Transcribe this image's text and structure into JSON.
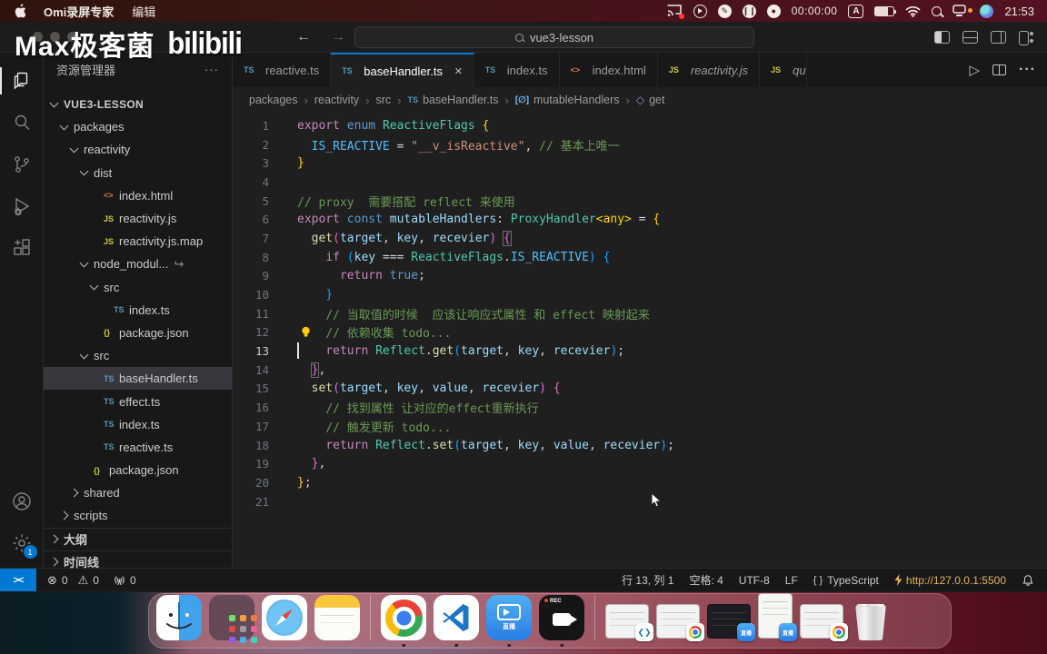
{
  "menubar": {
    "apps": [
      "Omi录屏专家",
      "编辑"
    ],
    "timer": "00:00:00",
    "input_source": "A",
    "time": "21:53"
  },
  "watermark": {
    "text": "Max极客菌",
    "logo": "bilibili"
  },
  "titlebar": {
    "search": "vue3-lesson"
  },
  "activity_bar": {
    "items": [
      "explorer",
      "search",
      "source-control",
      "run-debug",
      "extensions",
      "account",
      "settings"
    ],
    "settings_badge": "1"
  },
  "sidebar": {
    "title": "资源管理器",
    "more": "···",
    "tree": [
      {
        "label": "VUE3-LESSON",
        "chev": "down",
        "indent": 0,
        "root": true
      },
      {
        "label": "packages",
        "chev": "down",
        "indent": 1
      },
      {
        "label": "reactivity",
        "chev": "down",
        "indent": 2
      },
      {
        "label": "dist",
        "chev": "down",
        "indent": 3
      },
      {
        "label": "index.html",
        "icon": "html",
        "indent": 4
      },
      {
        "label": "reactivity.js",
        "icon": "js",
        "indent": 4
      },
      {
        "label": "reactivity.js.map",
        "icon": "js",
        "indent": 4
      },
      {
        "label": "node_modul...",
        "chev": "down",
        "indent": 3,
        "suffix": "↪"
      },
      {
        "label": "src",
        "chev": "down",
        "indent": 4
      },
      {
        "label": "index.ts",
        "icon": "ts",
        "indent": 5
      },
      {
        "label": "package.json",
        "icon": "json",
        "indent": 4
      },
      {
        "label": "src",
        "chev": "down",
        "indent": 3
      },
      {
        "label": "baseHandler.ts",
        "icon": "ts",
        "indent": 4,
        "selected": true
      },
      {
        "label": "effect.ts",
        "icon": "ts",
        "indent": 4
      },
      {
        "label": "index.ts",
        "icon": "ts",
        "indent": 4
      },
      {
        "label": "reactive.ts",
        "icon": "ts",
        "indent": 4
      },
      {
        "label": "package.json",
        "icon": "json",
        "indent": 3
      },
      {
        "label": "shared",
        "chev": "right",
        "indent": 2
      },
      {
        "label": "scripts",
        "chev": "right",
        "indent": 1
      },
      {
        "label": "大纲",
        "chev": "right",
        "indent": 0,
        "section": true
      },
      {
        "label": "时间线",
        "chev": "right",
        "indent": 0,
        "section": true
      }
    ]
  },
  "editor": {
    "tabs": [
      {
        "icon": "ts",
        "label": "reactive.ts"
      },
      {
        "icon": "ts",
        "label": "baseHandler.ts",
        "active": true,
        "close": "×"
      },
      {
        "icon": "ts",
        "label": "index.ts"
      },
      {
        "icon": "html",
        "label": "index.html"
      },
      {
        "icon": "js",
        "label": "reactivity.js",
        "italic": true
      },
      {
        "icon": "js",
        "label": "qu",
        "italic": true,
        "truncated": true
      }
    ],
    "actions": {
      "run": "▷",
      "more": "···"
    },
    "breadcrumb": [
      {
        "label": "packages"
      },
      {
        "label": "reactivity"
      },
      {
        "label": "src"
      },
      {
        "label": "baseHandler.ts",
        "icon": "ts"
      },
      {
        "label": "mutableHandlers",
        "icon": "symbol-variable",
        "glyph": "[∅]"
      },
      {
        "label": "get",
        "icon": "symbol-method",
        "glyph": "◇"
      }
    ],
    "code": {
      "cursor_line": 13,
      "bulb_line": 12,
      "lines": [
        {
          "n": "1",
          "t": [
            [
              "export ",
              "kw"
            ],
            [
              "enum ",
              "kw2"
            ],
            [
              "ReactiveFlags",
              "type"
            ],
            [
              " ",
              "pu"
            ],
            [
              "{",
              "b1"
            ]
          ]
        },
        {
          "n": "2",
          "t": [
            [
              "  ",
              "pu"
            ],
            [
              "IS_REACTIVE",
              "cn"
            ],
            [
              " = ",
              "pu"
            ],
            [
              "\"__v_isReactive\"",
              "st"
            ],
            [
              ",",
              "pu"
            ],
            [
              " ",
              "pu"
            ],
            [
              "// 基本上唯一",
              "cm"
            ]
          ]
        },
        {
          "n": "3",
          "t": [
            [
              "}",
              "b1"
            ]
          ]
        },
        {
          "n": "4",
          "t": []
        },
        {
          "n": "5",
          "t": [
            [
              "// proxy  需要搭配 reflect 来使用",
              "cm"
            ]
          ]
        },
        {
          "n": "6",
          "t": [
            [
              "export ",
              "kw"
            ],
            [
              "const ",
              "kw2"
            ],
            [
              "mutableHandlers",
              "vr"
            ],
            [
              ": ",
              "pu"
            ],
            [
              "ProxyHandler",
              "type"
            ],
            [
              "<any>",
              "b1"
            ],
            [
              " = ",
              "pu"
            ],
            [
              "{",
              "b1"
            ]
          ]
        },
        {
          "n": "7",
          "t": [
            [
              "  ",
              "pu"
            ],
            [
              "get",
              "fn"
            ],
            [
              "(",
              "b2"
            ],
            [
              "target",
              "vr"
            ],
            [
              ", ",
              "pu"
            ],
            [
              "key",
              "vr"
            ],
            [
              ", ",
              "pu"
            ],
            [
              "recevier",
              "vr"
            ],
            [
              ")",
              "b2"
            ],
            [
              " ",
              "pu"
            ],
            [
              "{",
              "bx"
            ]
          ]
        },
        {
          "n": "8",
          "t": [
            [
              "    ",
              "pu"
            ],
            [
              "if ",
              "kw"
            ],
            [
              "(",
              "b3"
            ],
            [
              "key",
              "vr"
            ],
            [
              " === ",
              "pu"
            ],
            [
              "ReactiveFlags",
              "type"
            ],
            [
              ".",
              "pu"
            ],
            [
              "IS_REACTIVE",
              "cn"
            ],
            [
              ")",
              "b3"
            ],
            [
              " ",
              "pu"
            ],
            [
              "{",
              "b3"
            ]
          ]
        },
        {
          "n": "9",
          "t": [
            [
              "      ",
              "pu"
            ],
            [
              "return ",
              "kw"
            ],
            [
              "true",
              "kw2"
            ],
            [
              ";",
              "pu"
            ]
          ]
        },
        {
          "n": "10",
          "t": [
            [
              "    ",
              "pu"
            ],
            [
              "}",
              "b3"
            ]
          ]
        },
        {
          "n": "11",
          "t": [
            [
              "    ",
              "pu"
            ],
            [
              "// 当取值的时候  应该让响应式属性 和 effect 映射起来",
              "cm"
            ]
          ]
        },
        {
          "n": "12",
          "t": [
            [
              "    ",
              "pu"
            ],
            [
              "// 依赖收集 todo...",
              "cm"
            ]
          ]
        },
        {
          "n": "13",
          "t": [
            [
              "    ",
              "pu"
            ],
            [
              "return ",
              "kw"
            ],
            [
              "Reflect",
              "type"
            ],
            [
              ".",
              "pu"
            ],
            [
              "get",
              "fn"
            ],
            [
              "(",
              "b3"
            ],
            [
              "target",
              "vr"
            ],
            [
              ", ",
              "pu"
            ],
            [
              "key",
              "vr"
            ],
            [
              ", ",
              "pu"
            ],
            [
              "recevier",
              "vr"
            ],
            [
              ")",
              "b3"
            ],
            [
              ";",
              "pu"
            ]
          ]
        },
        {
          "n": "14",
          "t": [
            [
              "  ",
              "pu"
            ],
            [
              "}",
              "bx"
            ],
            [
              ",",
              "pu"
            ]
          ]
        },
        {
          "n": "15",
          "t": [
            [
              "  ",
              "pu"
            ],
            [
              "set",
              "fn"
            ],
            [
              "(",
              "b2"
            ],
            [
              "target",
              "vr"
            ],
            [
              ", ",
              "pu"
            ],
            [
              "key",
              "vr"
            ],
            [
              ", ",
              "pu"
            ],
            [
              "value",
              "vr"
            ],
            [
              ", ",
              "pu"
            ],
            [
              "recevier",
              "vr"
            ],
            [
              ")",
              "b2"
            ],
            [
              " ",
              "pu"
            ],
            [
              "{",
              "b2"
            ]
          ]
        },
        {
          "n": "16",
          "t": [
            [
              "    ",
              "pu"
            ],
            [
              "// 找到属性 让对应的effect重新执行",
              "cm"
            ]
          ]
        },
        {
          "n": "17",
          "t": [
            [
              "    ",
              "pu"
            ],
            [
              "// 触发更新 todo...",
              "cm"
            ]
          ]
        },
        {
          "n": "18",
          "t": [
            [
              "    ",
              "pu"
            ],
            [
              "return ",
              "kw"
            ],
            [
              "Reflect",
              "type"
            ],
            [
              ".",
              "pu"
            ],
            [
              "set",
              "fn"
            ],
            [
              "(",
              "b3"
            ],
            [
              "target",
              "vr"
            ],
            [
              ", ",
              "pu"
            ],
            [
              "key",
              "vr"
            ],
            [
              ", ",
              "pu"
            ],
            [
              "value",
              "vr"
            ],
            [
              ", ",
              "pu"
            ],
            [
              "recevier",
              "vr"
            ],
            [
              ")",
              "b3"
            ],
            [
              ";",
              "pu"
            ]
          ]
        },
        {
          "n": "19",
          "t": [
            [
              "  ",
              "pu"
            ],
            [
              "}",
              "b2"
            ],
            [
              ",",
              "pu"
            ]
          ]
        },
        {
          "n": "20",
          "t": [
            [
              "}",
              "b1"
            ],
            [
              ";",
              "pu"
            ]
          ]
        },
        {
          "n": "21",
          "t": []
        }
      ]
    }
  },
  "statusbar": {
    "remote_glyph": "><",
    "errors": "0",
    "warnings": "0",
    "ports": "0",
    "line_col": "行 13, 列 1",
    "spaces": "空格: 4",
    "encoding": "UTF-8",
    "eol": "LF",
    "language_glyph": "{ }",
    "language": "TypeScript",
    "live_server_url": "http://127.0.0.1:5500"
  },
  "dock": {
    "live_label": "直播",
    "rec_label": "REC",
    "items": [
      {
        "name": "finder",
        "running": true
      },
      {
        "name": "launchpad"
      },
      {
        "name": "safari"
      },
      {
        "name": "notes"
      },
      {
        "name": "separator"
      },
      {
        "name": "chrome",
        "running": true
      },
      {
        "name": "vscode",
        "running": true
      },
      {
        "name": "bilibili-live",
        "running": true
      },
      {
        "name": "screen-recorder",
        "running": true
      },
      {
        "name": "separator"
      },
      {
        "name": "minimized-window",
        "badge": "vscode"
      },
      {
        "name": "minimized-window",
        "badge": "chrome"
      },
      {
        "name": "minimized-window",
        "badge": "live",
        "dark": true
      },
      {
        "name": "minimized-window",
        "badge": "live",
        "tall": true
      },
      {
        "name": "minimized-window",
        "badge": "chrome"
      },
      {
        "name": "trash"
      }
    ]
  },
  "colors": {
    "accent_blue": "#0078d4",
    "live_server_gold": "#e0b15c",
    "tab_active_border": "#0078d4"
  }
}
